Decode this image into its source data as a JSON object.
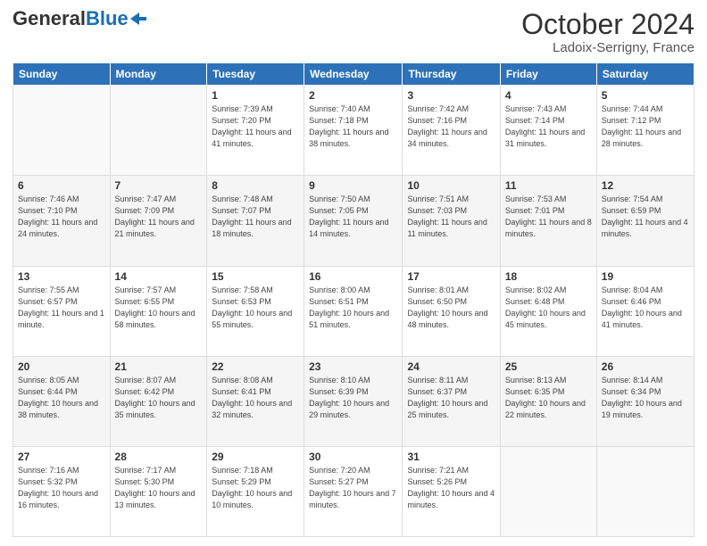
{
  "header": {
    "title": "October 2024",
    "subtitle": "Ladoix-Serrigny, France",
    "logo_general": "General",
    "logo_blue": "Blue"
  },
  "days_of_week": [
    "Sunday",
    "Monday",
    "Tuesday",
    "Wednesday",
    "Thursday",
    "Friday",
    "Saturday"
  ],
  "weeks": [
    [
      {
        "day": "",
        "info": ""
      },
      {
        "day": "",
        "info": ""
      },
      {
        "day": "1",
        "info": "Sunrise: 7:39 AM\nSunset: 7:20 PM\nDaylight: 11 hours and 41 minutes."
      },
      {
        "day": "2",
        "info": "Sunrise: 7:40 AM\nSunset: 7:18 PM\nDaylight: 11 hours and 38 minutes."
      },
      {
        "day": "3",
        "info": "Sunrise: 7:42 AM\nSunset: 7:16 PM\nDaylight: 11 hours and 34 minutes."
      },
      {
        "day": "4",
        "info": "Sunrise: 7:43 AM\nSunset: 7:14 PM\nDaylight: 11 hours and 31 minutes."
      },
      {
        "day": "5",
        "info": "Sunrise: 7:44 AM\nSunset: 7:12 PM\nDaylight: 11 hours and 28 minutes."
      }
    ],
    [
      {
        "day": "6",
        "info": "Sunrise: 7:46 AM\nSunset: 7:10 PM\nDaylight: 11 hours and 24 minutes."
      },
      {
        "day": "7",
        "info": "Sunrise: 7:47 AM\nSunset: 7:09 PM\nDaylight: 11 hours and 21 minutes."
      },
      {
        "day": "8",
        "info": "Sunrise: 7:48 AM\nSunset: 7:07 PM\nDaylight: 11 hours and 18 minutes."
      },
      {
        "day": "9",
        "info": "Sunrise: 7:50 AM\nSunset: 7:05 PM\nDaylight: 11 hours and 14 minutes."
      },
      {
        "day": "10",
        "info": "Sunrise: 7:51 AM\nSunset: 7:03 PM\nDaylight: 11 hours and 11 minutes."
      },
      {
        "day": "11",
        "info": "Sunrise: 7:53 AM\nSunset: 7:01 PM\nDaylight: 11 hours and 8 minutes."
      },
      {
        "day": "12",
        "info": "Sunrise: 7:54 AM\nSunset: 6:59 PM\nDaylight: 11 hours and 4 minutes."
      }
    ],
    [
      {
        "day": "13",
        "info": "Sunrise: 7:55 AM\nSunset: 6:57 PM\nDaylight: 11 hours and 1 minute."
      },
      {
        "day": "14",
        "info": "Sunrise: 7:57 AM\nSunset: 6:55 PM\nDaylight: 10 hours and 58 minutes."
      },
      {
        "day": "15",
        "info": "Sunrise: 7:58 AM\nSunset: 6:53 PM\nDaylight: 10 hours and 55 minutes."
      },
      {
        "day": "16",
        "info": "Sunrise: 8:00 AM\nSunset: 6:51 PM\nDaylight: 10 hours and 51 minutes."
      },
      {
        "day": "17",
        "info": "Sunrise: 8:01 AM\nSunset: 6:50 PM\nDaylight: 10 hours and 48 minutes."
      },
      {
        "day": "18",
        "info": "Sunrise: 8:02 AM\nSunset: 6:48 PM\nDaylight: 10 hours and 45 minutes."
      },
      {
        "day": "19",
        "info": "Sunrise: 8:04 AM\nSunset: 6:46 PM\nDaylight: 10 hours and 41 minutes."
      }
    ],
    [
      {
        "day": "20",
        "info": "Sunrise: 8:05 AM\nSunset: 6:44 PM\nDaylight: 10 hours and 38 minutes."
      },
      {
        "day": "21",
        "info": "Sunrise: 8:07 AM\nSunset: 6:42 PM\nDaylight: 10 hours and 35 minutes."
      },
      {
        "day": "22",
        "info": "Sunrise: 8:08 AM\nSunset: 6:41 PM\nDaylight: 10 hours and 32 minutes."
      },
      {
        "day": "23",
        "info": "Sunrise: 8:10 AM\nSunset: 6:39 PM\nDaylight: 10 hours and 29 minutes."
      },
      {
        "day": "24",
        "info": "Sunrise: 8:11 AM\nSunset: 6:37 PM\nDaylight: 10 hours and 25 minutes."
      },
      {
        "day": "25",
        "info": "Sunrise: 8:13 AM\nSunset: 6:35 PM\nDaylight: 10 hours and 22 minutes."
      },
      {
        "day": "26",
        "info": "Sunrise: 8:14 AM\nSunset: 6:34 PM\nDaylight: 10 hours and 19 minutes."
      }
    ],
    [
      {
        "day": "27",
        "info": "Sunrise: 7:16 AM\nSunset: 5:32 PM\nDaylight: 10 hours and 16 minutes."
      },
      {
        "day": "28",
        "info": "Sunrise: 7:17 AM\nSunset: 5:30 PM\nDaylight: 10 hours and 13 minutes."
      },
      {
        "day": "29",
        "info": "Sunrise: 7:18 AM\nSunset: 5:29 PM\nDaylight: 10 hours and 10 minutes."
      },
      {
        "day": "30",
        "info": "Sunrise: 7:20 AM\nSunset: 5:27 PM\nDaylight: 10 hours and 7 minutes."
      },
      {
        "day": "31",
        "info": "Sunrise: 7:21 AM\nSunset: 5:26 PM\nDaylight: 10 hours and 4 minutes."
      },
      {
        "day": "",
        "info": ""
      },
      {
        "day": "",
        "info": ""
      }
    ]
  ]
}
